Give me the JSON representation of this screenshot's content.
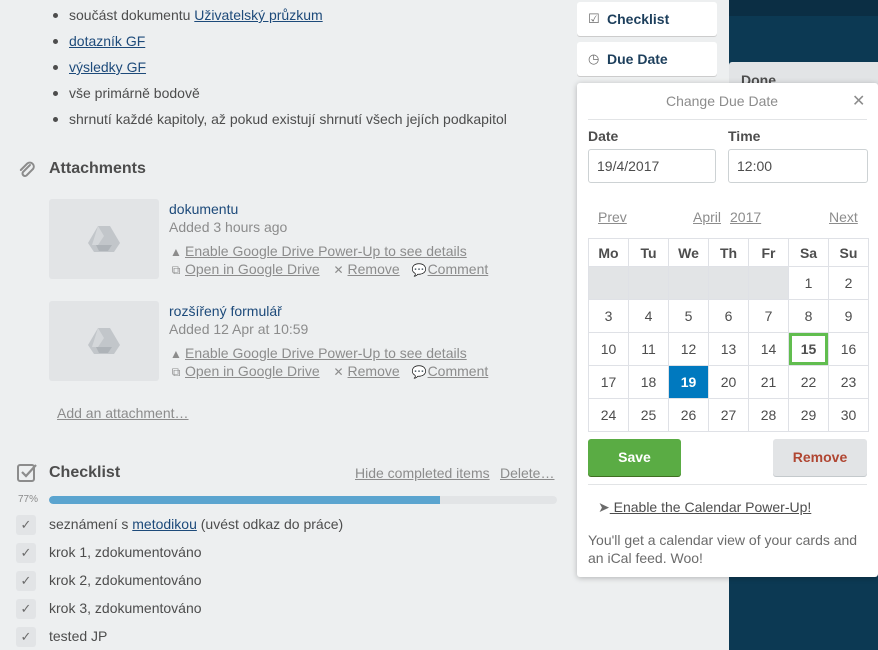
{
  "description_list": {
    "items": [
      {
        "prefix": "součást dokumentu ",
        "link": "Uživatelský průzkum"
      },
      {
        "prefix": "",
        "link": "dotazník GF"
      },
      {
        "prefix": "",
        "link": "výsledky GF"
      },
      {
        "prefix": "vše primárně bodově",
        "link": ""
      },
      {
        "prefix": "shrnutí každé kapitoly, až pokud existují shrnutí všech jejích podkapitol",
        "link": ""
      }
    ]
  },
  "attachments": {
    "title": "Attachments",
    "items": [
      {
        "name": "dokumentu",
        "added": "Added 3 hours ago",
        "enable": "Enable Google Drive Power-Up to see details",
        "open": "Open in Google Drive",
        "remove": "Remove",
        "comment": "Comment"
      },
      {
        "name": "rozšířený formulář",
        "added": "Added 12 Apr at 10:59",
        "enable": "Enable Google Drive Power-Up to see details",
        "open": "Open in Google Drive",
        "remove": "Remove",
        "comment": "Comment"
      }
    ],
    "add_label": "Add an attachment…"
  },
  "checklist": {
    "title": "Checklist",
    "hide_label": "Hide completed items",
    "delete_label": "Delete…",
    "percent_label": "77%",
    "progress": 0.77,
    "items": [
      {
        "prefix": "seznámení s ",
        "link": "metodikou",
        "suffix": " (uvést odkaz do práce)"
      },
      {
        "prefix": "krok 1, zdokumentováno",
        "link": "",
        "suffix": ""
      },
      {
        "prefix": "krok 2, zdokumentováno",
        "link": "",
        "suffix": ""
      },
      {
        "prefix": "krok 3, zdokumentováno",
        "link": "",
        "suffix": ""
      },
      {
        "prefix": "tested JP",
        "link": "",
        "suffix": ""
      }
    ]
  },
  "sidebar": {
    "checklist_label": "Checklist",
    "due_date_label": "Due Date"
  },
  "background": {
    "list_title": "Done"
  },
  "due_popover": {
    "title": "Change Due Date",
    "date_label": "Date",
    "time_label": "Time",
    "date_value": "19/4/2017",
    "time_value": "12:00",
    "prev": "Prev",
    "next": "Next",
    "month": "April",
    "year": "2017",
    "weekdays": [
      "Mo",
      "Tu",
      "We",
      "Th",
      "Fr",
      "Sa",
      "Su"
    ],
    "weeks": [
      [
        "",
        "",
        "",
        "",
        "",
        "1",
        "2"
      ],
      [
        "3",
        "4",
        "5",
        "6",
        "7",
        "8",
        "9"
      ],
      [
        "10",
        "11",
        "12",
        "13",
        "14",
        "15",
        "16"
      ],
      [
        "17",
        "18",
        "19",
        "20",
        "21",
        "22",
        "23"
      ],
      [
        "24",
        "25",
        "26",
        "27",
        "28",
        "29",
        "30"
      ]
    ],
    "selected_day": "19",
    "today_day": "15",
    "save_label": "Save",
    "remove_label": "Remove",
    "powerup_link": " Enable the Calendar Power-Up!",
    "powerup_desc": "You'll get a calendar view of your cards and an iCal feed. Woo!"
  },
  "colors": {
    "save_green": "#5aac44",
    "selected_blue": "#0079bf",
    "today_border": "#61bd4f",
    "progress_blue": "#5ba4cf",
    "remove_red": "#b04632",
    "board_bg": "#0c3953"
  }
}
